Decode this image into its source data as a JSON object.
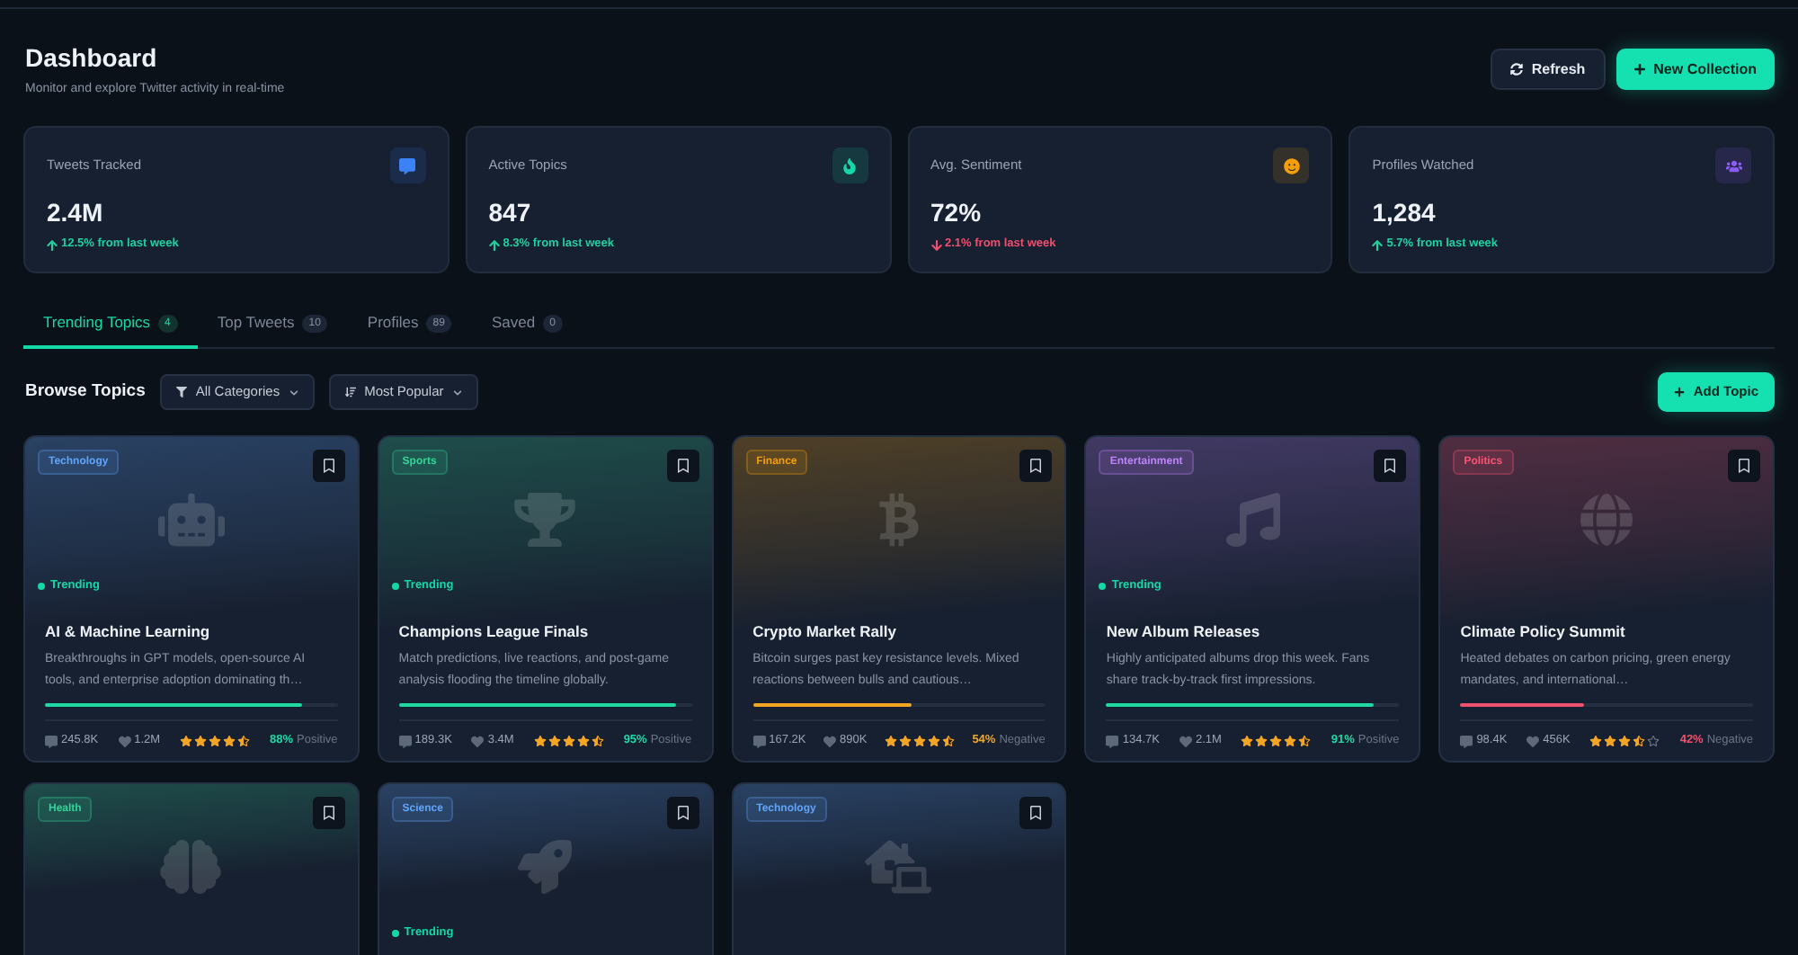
{
  "header": {
    "title": "Dashboard",
    "subtitle": "Monitor and explore Twitter activity in real-time",
    "refresh_button": {
      "label": "Refresh"
    },
    "new_button": {
      "label": "New Collection"
    }
  },
  "stats": [
    {
      "label": "Tweets Tracked",
      "value": "2.4M",
      "change": "12.5% from last week",
      "rising": true,
      "color": "#3b82f6"
    },
    {
      "label": "Active Topics",
      "value": "847",
      "change": "8.3% from last week",
      "rising": true,
      "color": "#14d9a6"
    },
    {
      "label": "Avg. Sentiment",
      "value": "72%",
      "change": "2.1% from last week",
      "rising": false,
      "color": "#f59e0b"
    },
    {
      "label": "Profiles Watched",
      "value": "1,284",
      "change": "5.7% from last week",
      "rising": true,
      "color": "#8b5cf6"
    }
  ],
  "tabs": [
    {
      "label": "Trending Topics",
      "count": "4",
      "selected": true
    },
    {
      "label": "Top Tweets",
      "count": "10",
      "selected": false
    },
    {
      "label": "Profiles",
      "count": "89",
      "selected": false
    },
    {
      "label": "Saved",
      "count": "0",
      "selected": false
    }
  ],
  "browse": {
    "title": "Browse Topics",
    "filters": [
      {
        "label": "All Categories",
        "kind": "filter"
      },
      {
        "label": "Most Popular",
        "kind": "sort"
      }
    ],
    "add_button": {
      "label": "Add Topic"
    }
  },
  "topics": [
    {
      "category": {
        "label": "Technology",
        "color": "#60a5fa"
      },
      "status": "Trending",
      "title": "AI & Machine Learning",
      "description": "Breakthroughs in GPT models, open-source AI tools, and enterprise adoption dominating th…",
      "level": 0.88,
      "comments": "245.8K",
      "likes": "1.2M",
      "stars": 4.5,
      "sentiment": {
        "percent": "88%",
        "label": "Positive",
        "color": "#1fd8a4"
      }
    },
    {
      "category": {
        "label": "Sports",
        "color": "#34d399"
      },
      "status": "Trending",
      "title": "Champions League Finals",
      "description": "Match predictions, live reactions, and post-game analysis flooding the timeline globally.",
      "level": 0.95,
      "comments": "189.3K",
      "likes": "3.4M",
      "stars": 4.5,
      "sentiment": {
        "percent": "95%",
        "label": "Positive",
        "color": "#1fd8a4"
      }
    },
    {
      "category": {
        "label": "Finance",
        "color": "#f59e0b"
      },
      "title": "Crypto Market Rally",
      "description": "Bitcoin surges past key resistance levels. Mixed reactions between bulls and cautious…",
      "level": 0.54,
      "comments": "167.2K",
      "likes": "890K",
      "stars": 4.5,
      "sentiment": {
        "percent": "54%",
        "label": "Negative",
        "color": "#f5a524"
      }
    },
    {
      "category": {
        "label": "Entertainment",
        "color": "#c084fc"
      },
      "status": "Trending",
      "title": "New Album Releases",
      "description": "Highly anticipated albums drop this week. Fans share track-by-track first impressions.",
      "level": 0.91,
      "comments": "134.7K",
      "likes": "2.1M",
      "stars": 4.5,
      "sentiment": {
        "percent": "91%",
        "label": "Positive",
        "color": "#1fd8a4"
      }
    },
    {
      "category": {
        "label": "Politics",
        "color": "#fb5573"
      },
      "title": "Climate Policy Summit",
      "description": "Heated debates on carbon pricing, green energy mandates, and international…",
      "level": 0.42,
      "comments": "98.4K",
      "likes": "456K",
      "stars": 3.5,
      "sentiment": {
        "percent": "42%",
        "label": "Negative",
        "color": "#f0506e"
      }
    },
    {
      "category": {
        "label": "Health",
        "color": "#34d399"
      }
    },
    {
      "category": {
        "label": "Science",
        "color": "#60a5fa"
      },
      "status": "Trending"
    },
    {
      "category": {
        "label": "Technology",
        "color": "#60a5fa"
      }
    }
  ]
}
